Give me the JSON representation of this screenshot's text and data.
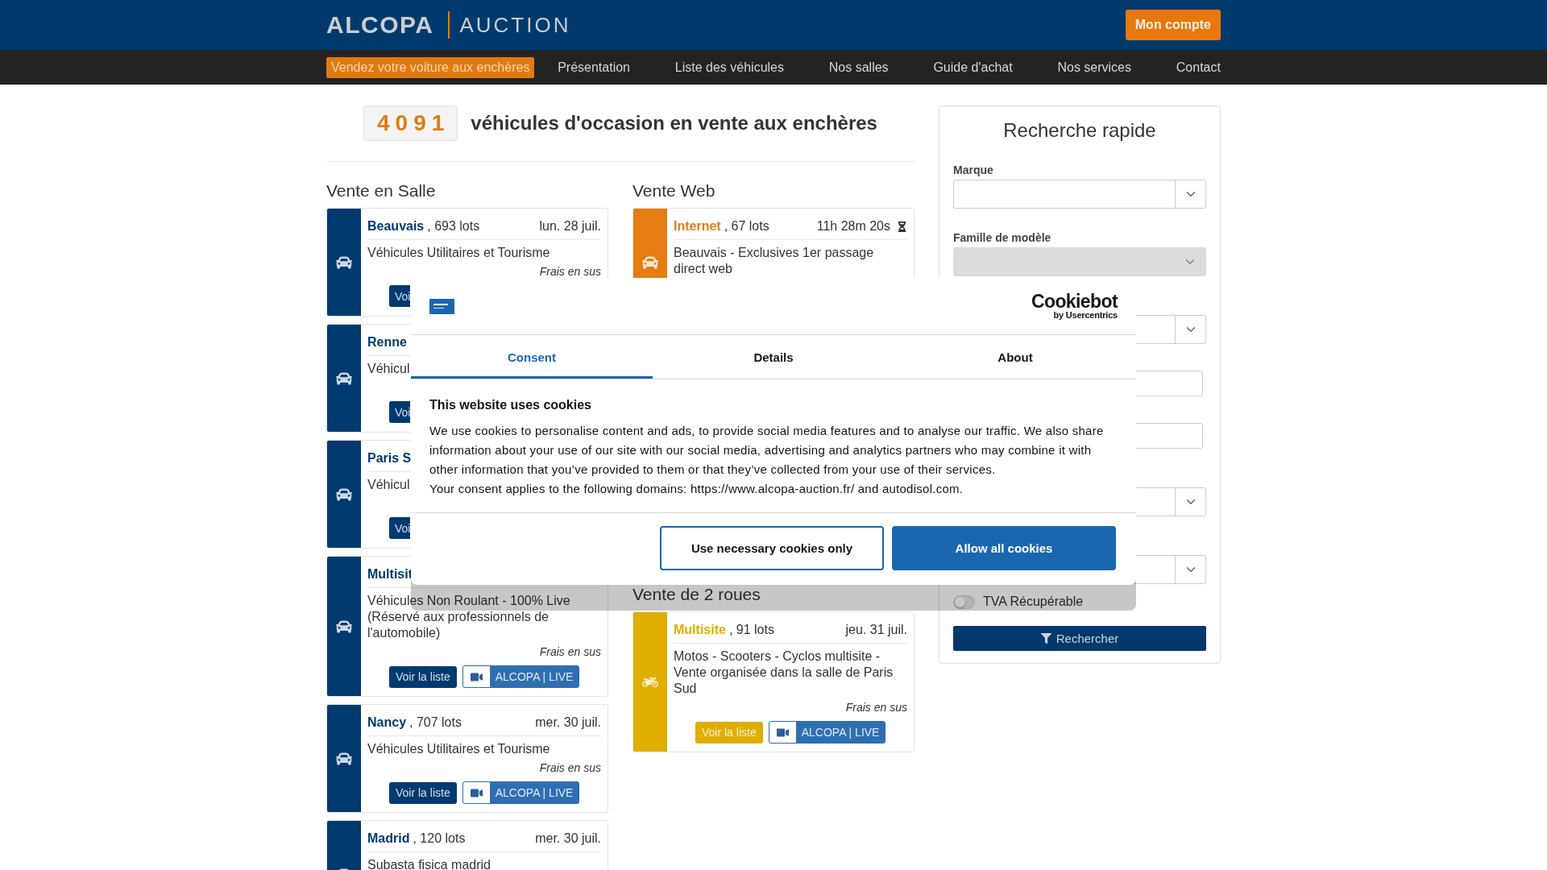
{
  "header": {
    "logo": {
      "brand": "ALCOPA",
      "suffix": "AUCTION"
    },
    "account_button": "Mon compte"
  },
  "nav": [
    {
      "label": "Vendez votre voiture aux enchères",
      "highlighted": true
    },
    {
      "label": "Présentation",
      "highlighted": false
    },
    {
      "label": "Liste des véhicules",
      "highlighted": false
    },
    {
      "label": "Nos salles",
      "highlighted": false
    },
    {
      "label": "Guide d'achat",
      "highlighted": false
    },
    {
      "label": "Nos services",
      "highlighted": false
    },
    {
      "label": "Contact",
      "highlighted": false
    }
  ],
  "summary": {
    "count": "4091",
    "title": "véhicules d'occasion en vente aux enchères"
  },
  "columns": [
    {
      "sections": [
        {
          "title": "Vente en Salle",
          "kind": "hall",
          "color": "#003a70",
          "cards": [
            {
              "name": "Beauvais",
              "lots": ", 693 lots",
              "date": "lun. 28 juil.",
              "description": "Véhicules Utilitaires et Tourisme",
              "fees": "Frais en sus",
              "list_button": "Voi"
            },
            {
              "name": "Renne",
              "description": "Véhicul",
              "list_button": "Voi"
            },
            {
              "name": "Paris S",
              "description": "Véhicul",
              "list_button": "Voi"
            },
            {
              "name": "Multisit",
              "description": "Véhicules Non Roulant - 100% Live (Réservé aux professionnels de l'automobile)",
              "fees": "Frais en sus",
              "list_button": "Voir la liste",
              "live_button": "ALCOPA | LIVE"
            },
            {
              "name": "Nancy",
              "lots": ", 707 lots",
              "date": "mer. 30 juil.",
              "description": "Véhicules Utilitaires et Tourisme",
              "fees": "Frais en sus",
              "list_button": "Voir la liste",
              "live_button": "ALCOPA | LIVE"
            },
            {
              "name": "Madrid",
              "lots": ", 120 lots",
              "date": "mer. 30 juil.",
              "description": "Subasta fisica madrid"
            }
          ]
        }
      ]
    },
    {
      "sections": [
        {
          "title": "Vente Web",
          "kind": "web",
          "color": "#e47d14",
          "cards": [
            {
              "name": "Internet",
              "lots": ", 67 lots",
              "countdown": "11h 28m 20s",
              "description": "Beauvais - Exclusives 1er passage direct web"
            }
          ]
        },
        {
          "title": "Vente de 2 roues",
          "kind": "two_wheels",
          "color": "#dfae00",
          "cards": [
            {
              "name": "Multisite",
              "lots": ", 91 lots",
              "date": "jeu. 31 juil.",
              "description": "Motos - Scooters - Cyclos multisite - Vente organisée dans la salle de Paris Sud",
              "fees": "Frais en sus",
              "list_button": "Voir la liste",
              "live_button": "ALCOPA | LIVE"
            }
          ]
        }
      ]
    }
  ],
  "quick_search": {
    "title": "Recherche rapide",
    "fields": [
      {
        "kind": "select",
        "label": "Marque",
        "disabled": false
      },
      {
        "kind": "select",
        "label": "Famille de modèle",
        "disabled": true
      },
      {
        "kind": "select",
        "disabled": false
      },
      {
        "kind": "text",
        "disabled": false
      },
      {
        "kind": "text",
        "disabled": false
      },
      {
        "kind": "select",
        "disabled": false
      },
      {
        "kind": "select",
        "disabled": false
      }
    ],
    "toggle": {
      "label": "TVA Récupérable",
      "on": false
    },
    "submit": "Rechercher"
  },
  "cookie_dialog": {
    "provider": {
      "name": "Cookiebot",
      "byline": "by Usercentrics"
    },
    "tabs": [
      {
        "label": "Consent",
        "selected": true
      },
      {
        "label": "Details",
        "selected": false
      },
      {
        "label": "About",
        "selected": false
      }
    ],
    "heading": "This website uses cookies",
    "paragraphs": [
      "We use cookies to personalise content and ads, to provide social media features and to analyse our traffic. We also share information about your use of our site with our social media, advertising and analytics partners who may combine it with other information that you’ve provided to them or that they’ve collected from your use of their services.",
      "Your consent applies to the following domains: https://www.alcopa-auction.fr/ and autodisol.com."
    ],
    "buttons": [
      {
        "label": "Use necessary cookies only",
        "kind": "outline"
      },
      {
        "label": "Allow all cookies",
        "kind": "primary"
      }
    ]
  }
}
